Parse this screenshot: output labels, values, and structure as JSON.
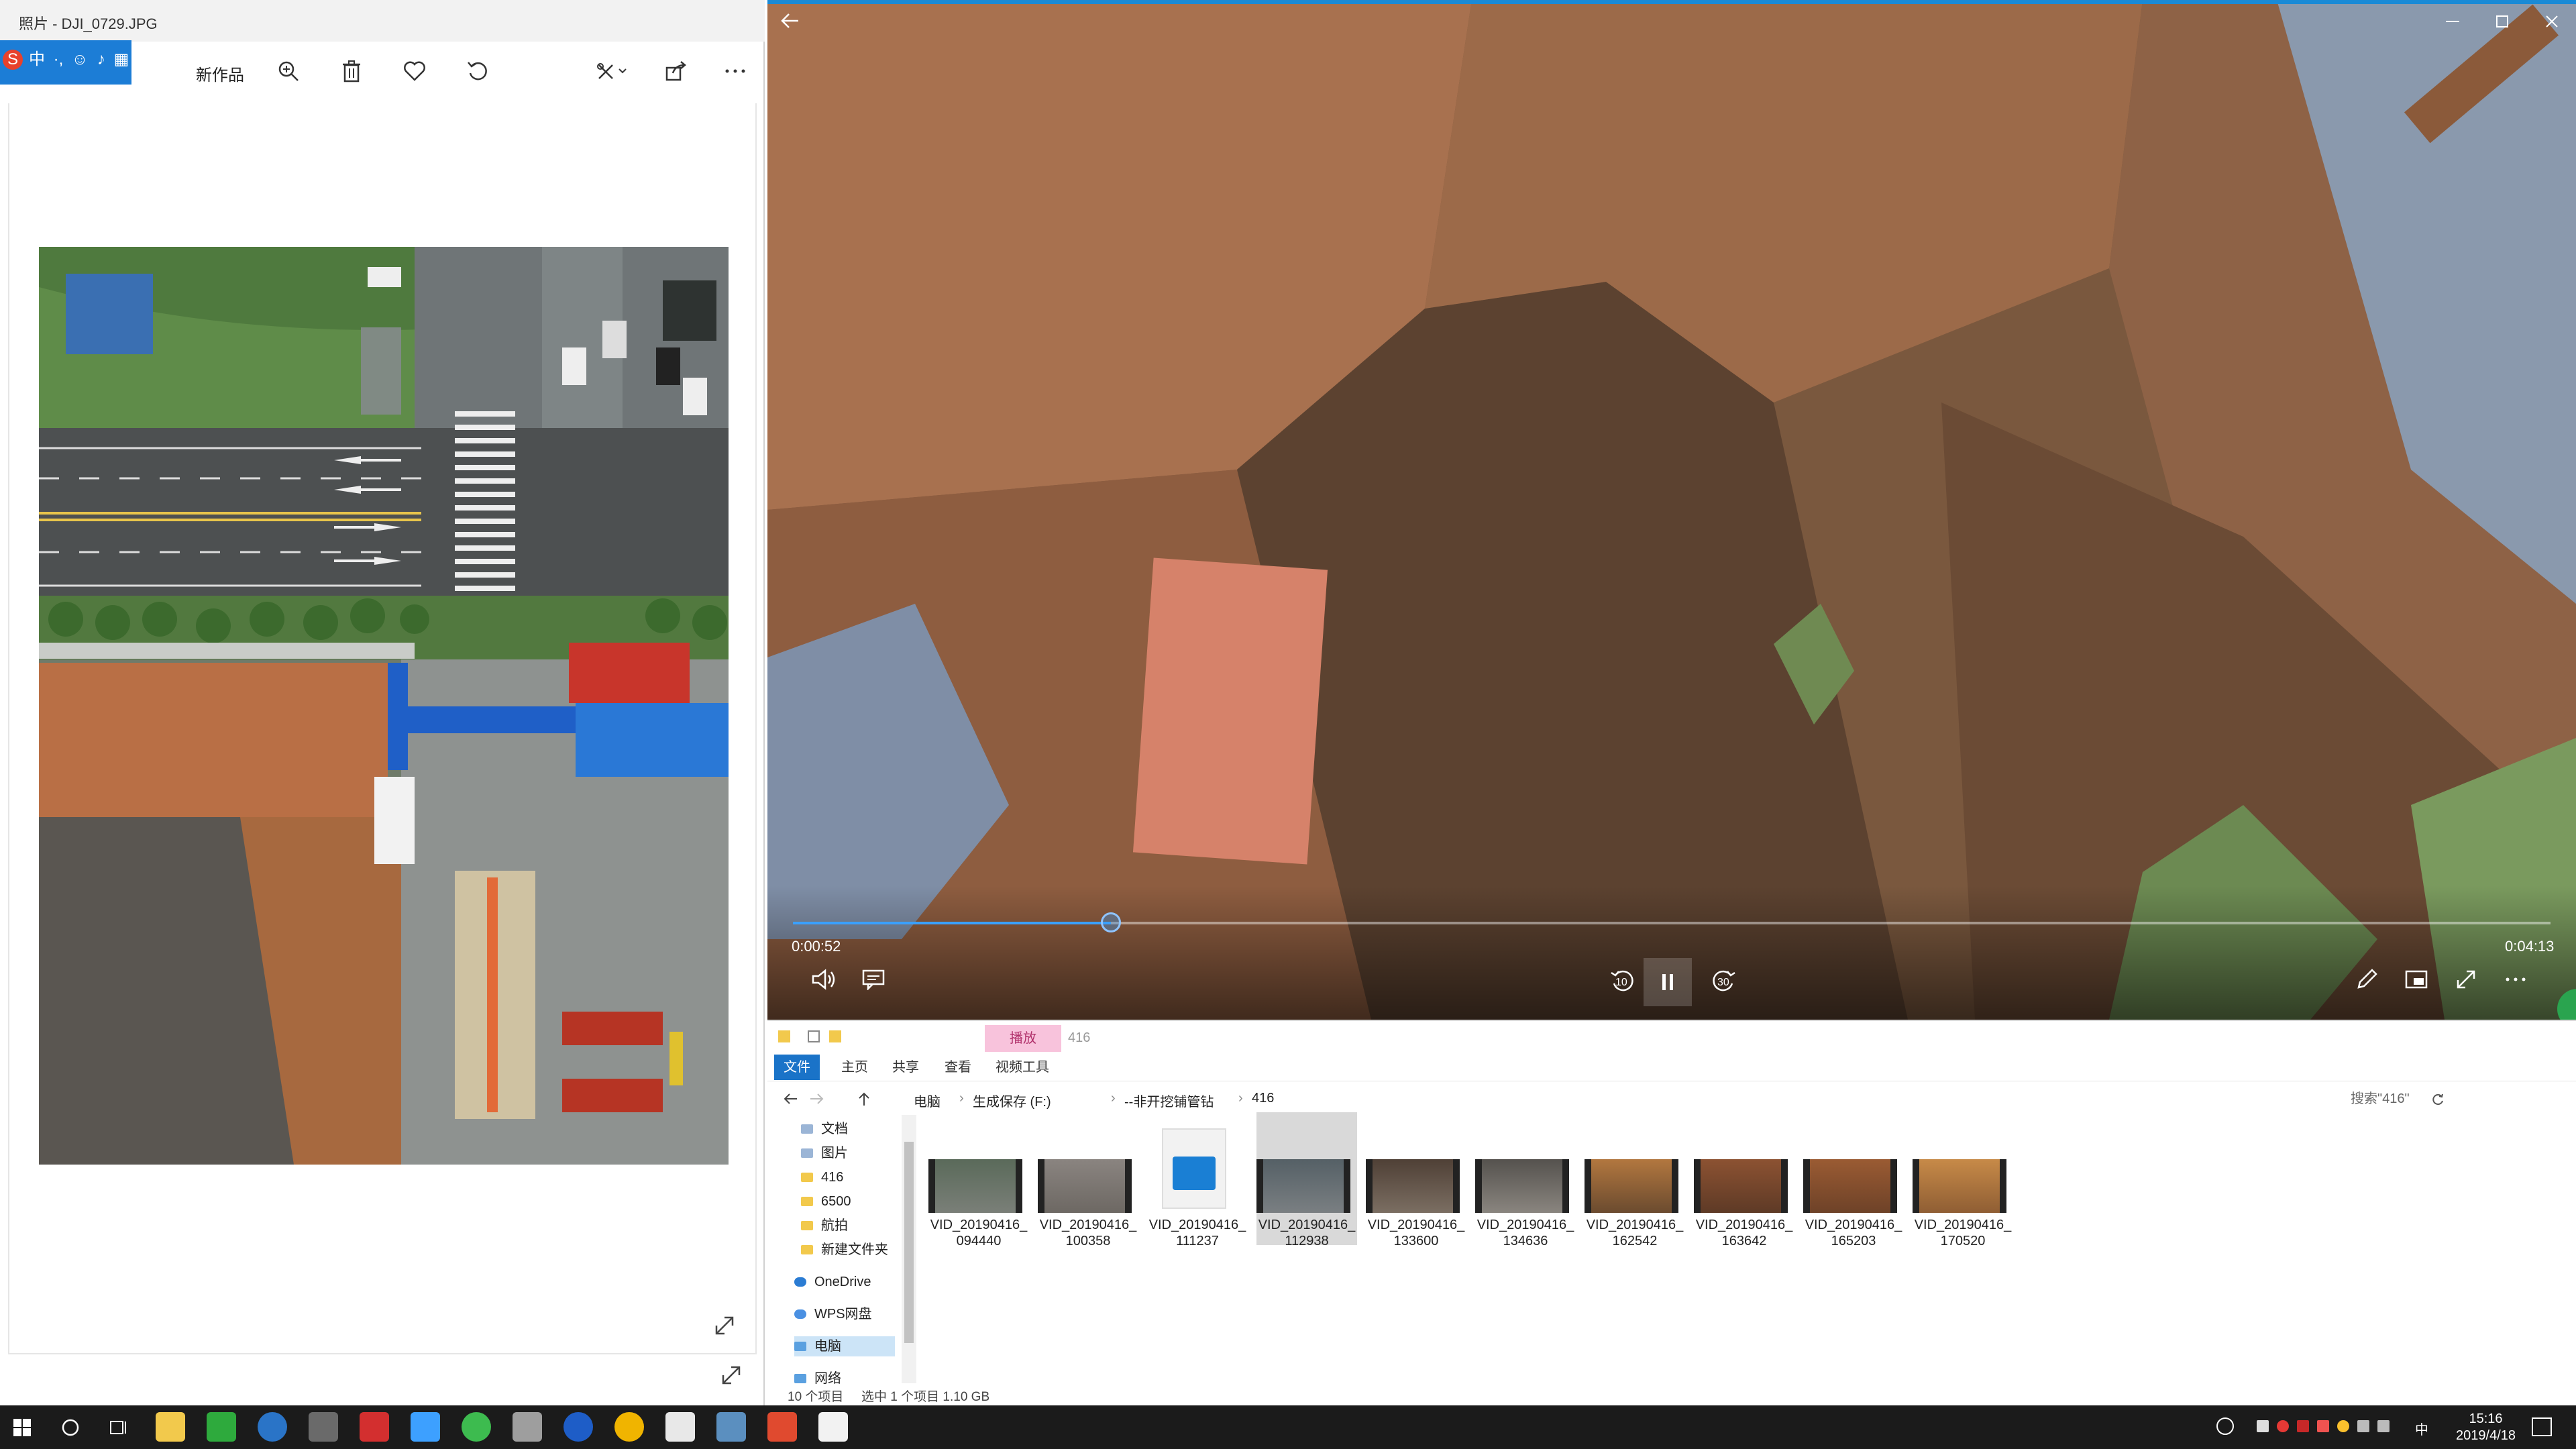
{
  "photos_app": {
    "title": "照片 - DJI_0729.JPG",
    "toolbar": {
      "new_creation_label": "新作品",
      "icons": [
        "zoom-icon",
        "delete-icon",
        "favorite-icon",
        "rotate-icon",
        "edit-icon",
        "share-icon",
        "more-icon"
      ]
    },
    "ime_icons": [
      "sogou-logo",
      "chinese-mode",
      "punctuation",
      "emoji",
      "voice",
      "keyboard",
      "toolbox",
      "skin",
      "menu"
    ],
    "ime_labels": {
      "mode": "中"
    }
  },
  "video_player": {
    "current_time": "0:00:52",
    "total_time": "0:04:13",
    "progress": 0.181,
    "controls": {
      "rewind_label": "10",
      "forward_label": "30"
    }
  },
  "explorer": {
    "context_tab": "播放",
    "context_folder": "416",
    "tabs": [
      "文件",
      "主页",
      "共享",
      "查看",
      "视频工具"
    ],
    "breadcrumb": [
      "电脑",
      "生成保存 (F:)",
      "--非开挖铺管钻",
      "416"
    ],
    "search_placeholder": "搜索\"416\"",
    "nav_items": [
      "文档",
      "图片",
      "416",
      "6500",
      "航拍",
      "新建文件夹",
      "OneDrive",
      "WPS网盘",
      "电脑",
      "网络"
    ],
    "files": [
      {
        "line1": "VID_20190416_",
        "line2": "094440"
      },
      {
        "line1": "VID_20190416_",
        "line2": "100358"
      },
      {
        "line1": "VID_20190416_",
        "line2": "111237"
      },
      {
        "line1": "VID_20190416_",
        "line2": "112938"
      },
      {
        "line1": "VID_20190416_",
        "line2": "133600"
      },
      {
        "line1": "VID_20190416_",
        "line2": "134636"
      },
      {
        "line1": "VID_20190416_",
        "line2": "162542"
      },
      {
        "line1": "VID_20190416_",
        "line2": "163642"
      },
      {
        "line1": "VID_20190416_",
        "line2": "165203"
      },
      {
        "line1": "VID_20190416_",
        "line2": "170520"
      }
    ],
    "status_count": "10 个项目",
    "status_selected": "选中 1 个项目  1.10 GB"
  },
  "taskbar": {
    "time": "15:16",
    "date": "2019/4/18",
    "ime_indicator": "中"
  },
  "colors": {
    "accent": "#1a8ad6",
    "ime_blue": "#1c7dd6",
    "context_pink": "#f8c3dc",
    "taskbar": "#1b1b1b"
  }
}
